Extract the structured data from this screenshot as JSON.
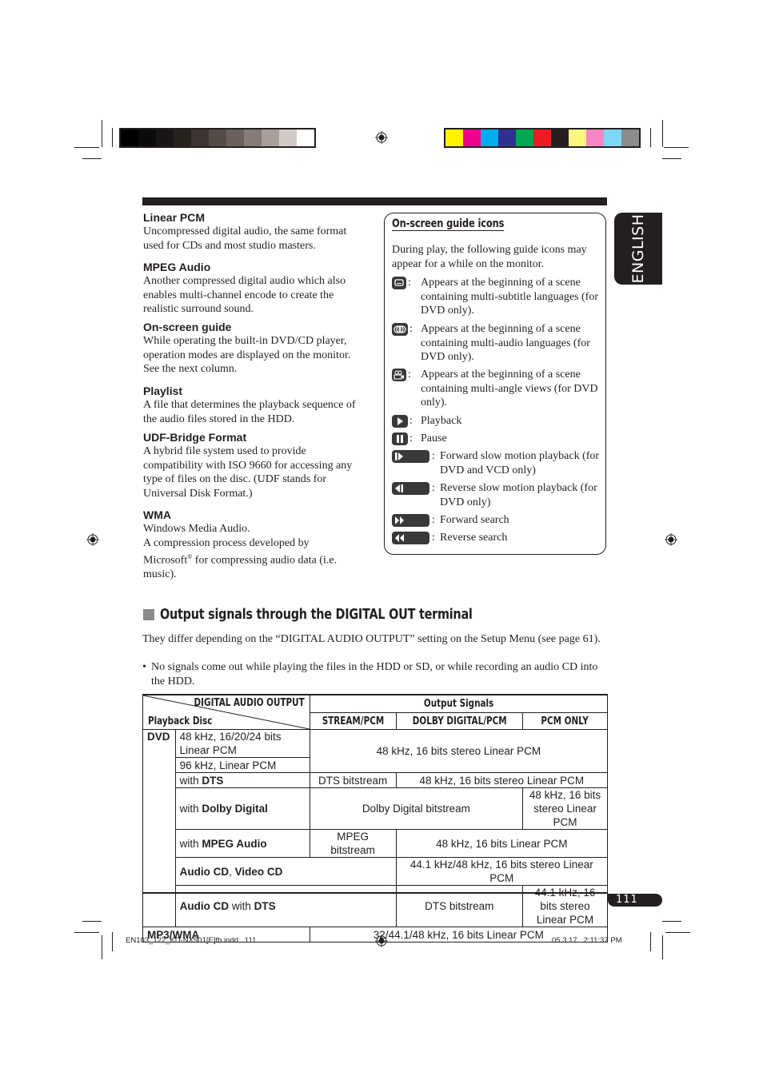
{
  "print_marks": {
    "grayscale_swatches": [
      "#000000",
      "#0d0b0a",
      "#1a1615",
      "#28221f",
      "#3d3533",
      "#544a47",
      "#6b605d",
      "#857b78",
      "#a89e9c",
      "#d3cac8",
      "#ffffff"
    ],
    "color_swatches": [
      "#fff200",
      "#ec008c",
      "#00aeef",
      "#2e3192",
      "#00a651",
      "#ed1c24",
      "#231f20",
      "#fff57f",
      "#f587c4",
      "#7fd7f7",
      "#8c8c8c"
    ]
  },
  "language_tab": "ENGLISH",
  "glossary": [
    {
      "term": "Linear PCM",
      "definition": "Uncompressed digital audio, the same format used for CDs and most studio masters."
    },
    {
      "term": "MPEG Audio",
      "definition": "Another compressed digital audio which also enables multi-channel encode to create the realistic surround sound."
    },
    {
      "term": "On-screen guide",
      "definition": "While operating the built-in DVD/CD player, operation modes are displayed on the monitor. See the next column."
    },
    {
      "term": "Playlist",
      "definition": "A file that determines the playback sequence of the audio files stored in the HDD."
    },
    {
      "term": "UDF-Bridge Format",
      "definition": "A hybrid file system used to provide compatibility with ISO 9660 for accessing any type of files on the disc. (UDF stands for Universal Disk Format.)"
    },
    {
      "term": "WMA",
      "definition_line1": "Windows Media Audio.",
      "definition_line2_pre": "A compression process developed by Microsoft",
      "definition_reg": "®",
      "definition_line2_post": " for compressing audio data (i.e. music)."
    }
  ],
  "guide_icons": {
    "title": "On-screen guide icons",
    "intro": "During play, the following guide icons may appear for a while on the monitor.",
    "items": [
      {
        "icon": "subtitle-icon",
        "text": "Appears at the beginning of a scene containing multi-subtitle languages (for DVD only)."
      },
      {
        "icon": "audio-language-icon",
        "text": "Appears at the beginning of a scene containing multi-audio languages (for DVD only)."
      },
      {
        "icon": "angle-icon",
        "text": "Appears at the beginning of a scene containing multi-angle views (for DVD only)."
      },
      {
        "icon": "play-icon",
        "text": "Playback"
      },
      {
        "icon": "pause-icon",
        "text": "Pause"
      },
      {
        "icon": "forward-slow-icon",
        "text": "Forward slow motion playback (for DVD and VCD only)"
      },
      {
        "icon": "reverse-slow-icon",
        "text": "Reverse slow motion playback (for DVD only)"
      },
      {
        "icon": "forward-search-icon",
        "text": "Forward search"
      },
      {
        "icon": "reverse-search-icon",
        "text": "Reverse search"
      }
    ]
  },
  "output_section": {
    "title": "Output signals through the DIGITAL OUT terminal",
    "intro": "They differ depending on the “DIGITAL AUDIO OUTPUT” setting on the Setup Menu (see page 61).",
    "bullet": "No signals come out while playing the files in the HDD or SD, or while recording an audio CD into the HDD.",
    "table": {
      "corner_top": "DIGITAL AUDIO OUTPUT",
      "corner_bottom": "Playback Disc",
      "output_header": "Output Signals",
      "columns": [
        "STREAM/PCM",
        "DOLBY DIGITAL/PCM",
        "PCM ONLY"
      ],
      "dvd_label": "DVD",
      "with": "with",
      "rows": {
        "dvd_48k": "48 kHz, 16/20/24 bits Linear PCM",
        "dvd_96k": "96 kHz, Linear PCM",
        "dvd_pcm_out": "48 kHz, 16 bits stereo Linear PCM",
        "dts": "DTS",
        "dts_stream": "DTS bitstream",
        "dts_other": "48 kHz, 16 bits stereo Linear PCM",
        "dolby": "Dolby Digital",
        "dolby_stream": "Dolby Digital bitstream",
        "dolby_pcm_only": "48 kHz, 16 bits stereo Linear PCM",
        "mpeg": "MPEG Audio",
        "mpeg_stream": "MPEG bitstream",
        "mpeg_other": "48 kHz, 16 bits Linear PCM",
        "acd_label_a": "Audio CD",
        "acd_label_sep": ", ",
        "acd_label_b": "Video CD",
        "acd_out": "44.1 kHz/48 kHz, 16 bits stereo Linear PCM",
        "acd_dts_a": "Audio CD",
        "acd_dts_with": " with ",
        "acd_dts_b": "DTS",
        "acd_dts_stream": "DTS bitstream",
        "acd_dts_other": "44.1 kHz, 16 bits stereo Linear PCM",
        "mp3_label": "MP3/WMA",
        "mp3_out": "32/44.1/48 kHz, 16 bits Linear PCM"
      }
    }
  },
  "page_number": "111",
  "footer": {
    "file": "EN103_122_KD-NX901[E]fb.indd   111",
    "timestamp": "05.3.17   2:11:37 PM"
  }
}
